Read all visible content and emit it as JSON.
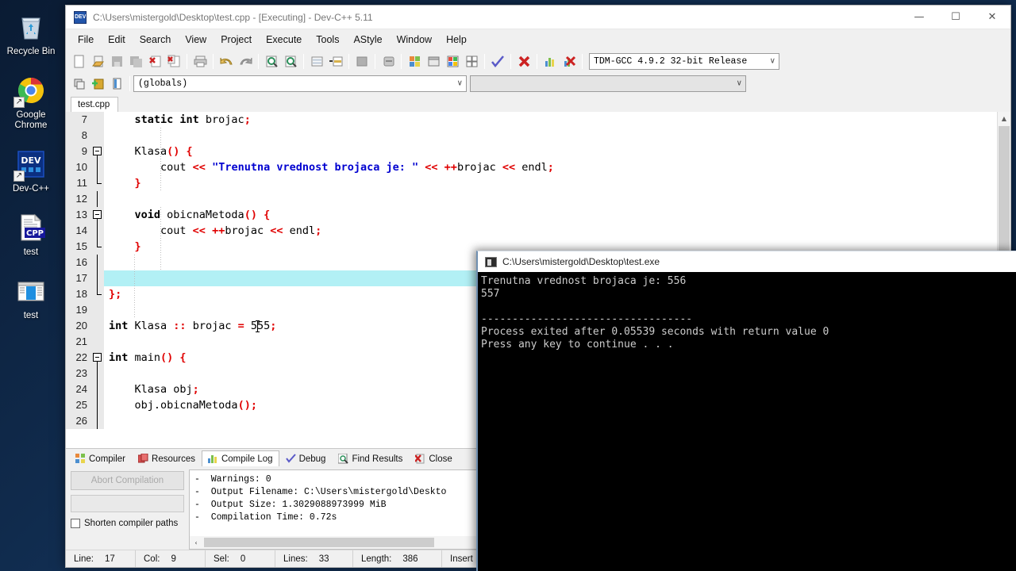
{
  "desktop": {
    "icons": [
      {
        "label": "Recycle Bin",
        "icon": "recycle-bin-icon",
        "shortcut": false
      },
      {
        "label": "Google Chrome",
        "icon": "chrome-icon",
        "shortcut": true
      },
      {
        "label": "Dev-C++",
        "icon": "devcpp-icon",
        "shortcut": true
      },
      {
        "label": "test",
        "icon": "cpp-file-icon",
        "shortcut": false
      },
      {
        "label": "test",
        "icon": "exe-file-icon",
        "shortcut": false
      }
    ]
  },
  "window": {
    "title": "C:\\Users\\mistergold\\Desktop\\test.cpp - [Executing] - Dev-C++ 5.11",
    "minimize": "—",
    "maximize": "☐",
    "close": "✕"
  },
  "menubar": {
    "items": [
      "File",
      "Edit",
      "Search",
      "View",
      "Project",
      "Execute",
      "Tools",
      "AStyle",
      "Window",
      "Help"
    ]
  },
  "toolbar": {
    "compiler_select": "TDM-GCC 4.9.2 32-bit Release",
    "scope_select": "(globals)",
    "scope_select2": "",
    "dropdown_arrow": "∨"
  },
  "tabs": {
    "open_file": "test.cpp"
  },
  "editor": {
    "caret": {
      "line": 20,
      "col": 9
    },
    "highlight_line": 17,
    "lines": [
      {
        "num": 7,
        "fold": "none",
        "indent": 1,
        "tokens": [
          {
            "t": "    ",
            "c": "id"
          },
          {
            "t": "static int ",
            "c": "kw"
          },
          {
            "t": "brojac",
            "c": "id"
          },
          {
            "t": ";",
            "c": "pnc"
          }
        ]
      },
      {
        "num": 8,
        "fold": "none",
        "indent": 1,
        "tokens": []
      },
      {
        "num": 9,
        "fold": "open",
        "indent": 1,
        "tokens": [
          {
            "t": "    ",
            "c": "id"
          },
          {
            "t": "Klasa",
            "c": "id"
          },
          {
            "t": "() {",
            "c": "pnc"
          }
        ]
      },
      {
        "num": 10,
        "fold": "bar",
        "indent": 2,
        "tokens": [
          {
            "t": "        ",
            "c": "id"
          },
          {
            "t": "cout ",
            "c": "id"
          },
          {
            "t": "<< ",
            "c": "pnc"
          },
          {
            "t": "\"Trenutna vrednost brojaca je: \"",
            "c": "str"
          },
          {
            "t": " << ",
            "c": "pnc"
          },
          {
            "t": "++",
            "c": "pnc"
          },
          {
            "t": "brojac ",
            "c": "id"
          },
          {
            "t": "<< ",
            "c": "pnc"
          },
          {
            "t": "endl",
            "c": "id"
          },
          {
            "t": ";",
            "c": "pnc"
          }
        ]
      },
      {
        "num": 11,
        "fold": "end",
        "indent": 1,
        "tokens": [
          {
            "t": "    ",
            "c": "id"
          },
          {
            "t": "}",
            "c": "pnc"
          }
        ]
      },
      {
        "num": 12,
        "fold": "bar",
        "indent": 1,
        "tokens": []
      },
      {
        "num": 13,
        "fold": "open",
        "indent": 1,
        "tokens": [
          {
            "t": "    ",
            "c": "id"
          },
          {
            "t": "void ",
            "c": "kw"
          },
          {
            "t": "obicnaMetoda",
            "c": "id"
          },
          {
            "t": "() {",
            "c": "pnc"
          }
        ]
      },
      {
        "num": 14,
        "fold": "bar",
        "indent": 2,
        "tokens": [
          {
            "t": "        ",
            "c": "id"
          },
          {
            "t": "cout ",
            "c": "id"
          },
          {
            "t": "<< ",
            "c": "pnc"
          },
          {
            "t": "++",
            "c": "pnc"
          },
          {
            "t": "brojac ",
            "c": "id"
          },
          {
            "t": "<< ",
            "c": "pnc"
          },
          {
            "t": "endl",
            "c": "id"
          },
          {
            "t": ";",
            "c": "pnc"
          }
        ]
      },
      {
        "num": 15,
        "fold": "end",
        "indent": 1,
        "tokens": [
          {
            "t": "    ",
            "c": "id"
          },
          {
            "t": "}",
            "c": "pnc"
          }
        ]
      },
      {
        "num": 16,
        "fold": "bar",
        "indent": 1,
        "tokens": []
      },
      {
        "num": 17,
        "fold": "bar",
        "indent": 1,
        "tokens": []
      },
      {
        "num": 18,
        "fold": "close",
        "indent": 0,
        "tokens": [
          {
            "t": "};",
            "c": "pnc"
          }
        ]
      },
      {
        "num": 19,
        "fold": "none",
        "indent": 0,
        "tokens": []
      },
      {
        "num": 20,
        "fold": "none",
        "indent": 0,
        "tokens": [
          {
            "t": "int ",
            "c": "kw"
          },
          {
            "t": "Klasa ",
            "c": "id"
          },
          {
            "t": ":: ",
            "c": "pnc"
          },
          {
            "t": "brojac ",
            "c": "id"
          },
          {
            "t": "= ",
            "c": "pnc"
          },
          {
            "t": "555",
            "c": "id"
          },
          {
            "t": ";",
            "c": "pnc"
          }
        ]
      },
      {
        "num": 21,
        "fold": "none",
        "indent": 0,
        "tokens": []
      },
      {
        "num": 22,
        "fold": "open",
        "indent": 0,
        "tokens": [
          {
            "t": "int ",
            "c": "kw"
          },
          {
            "t": "main",
            "c": "id"
          },
          {
            "t": "() {",
            "c": "pnc"
          }
        ]
      },
      {
        "num": 23,
        "fold": "bar",
        "indent": 0,
        "tokens": []
      },
      {
        "num": 24,
        "fold": "bar",
        "indent": 1,
        "tokens": [
          {
            "t": "    ",
            "c": "id"
          },
          {
            "t": "Klasa obj",
            "c": "id"
          },
          {
            "t": ";",
            "c": "pnc"
          }
        ]
      },
      {
        "num": 25,
        "fold": "bar",
        "indent": 1,
        "tokens": [
          {
            "t": "    ",
            "c": "id"
          },
          {
            "t": "obj.obicnaMetoda",
            "c": "id"
          },
          {
            "t": "();",
            "c": "pnc"
          }
        ]
      },
      {
        "num": 26,
        "fold": "bar",
        "indent": 1,
        "tokens": []
      }
    ],
    "scroll_up": "▲",
    "scroll_down": "▼"
  },
  "bottom_panel": {
    "tabs": [
      {
        "label": "Compiler",
        "icon": "compiler-icon",
        "active": false
      },
      {
        "label": "Resources",
        "icon": "resources-icon",
        "active": false
      },
      {
        "label": "Compile Log",
        "icon": "compile-log-icon",
        "active": true
      },
      {
        "label": "Debug",
        "icon": "debug-check-icon",
        "active": false
      },
      {
        "label": "Find Results",
        "icon": "find-results-icon",
        "active": false
      },
      {
        "label": "Close",
        "icon": "close-x-icon",
        "active": false
      }
    ],
    "abort_button": "Abort Compilation",
    "shorten_paths_label": "Shorten compiler paths",
    "log_lines": [
      "-  Warnings: 0",
      "-  Output Filename: C:\\Users\\mistergold\\Deskto",
      "-  Output Size: 1.3029088973999 MiB",
      "-  Compilation Time: 0.72s"
    ],
    "hscroll_left": "‹"
  },
  "statusbar": {
    "cells": [
      {
        "label": "Line:",
        "value": "17"
      },
      {
        "label": "Col:",
        "value": "9"
      },
      {
        "label": "Sel:",
        "value": "0"
      },
      {
        "label": "Lines:",
        "value": "33"
      },
      {
        "label": "Length:",
        "value": "386"
      },
      {
        "label": "Insert",
        "value": ""
      }
    ]
  },
  "console": {
    "title": "C:\\Users\\mistergold\\Desktop\\test.exe",
    "output": "Trenutna vrednost brojaca je: 556\n557\n\n----------------------------------\nProcess exited after 0.05539 seconds with return value 0\nPress any key to continue . . ."
  },
  "colors": {
    "keyword": "#000000",
    "punctuation": "#e00000",
    "string": "#0000d0",
    "current_line": "#b2f0f5",
    "console_bg": "#000000",
    "console_fg": "#cccccc"
  }
}
